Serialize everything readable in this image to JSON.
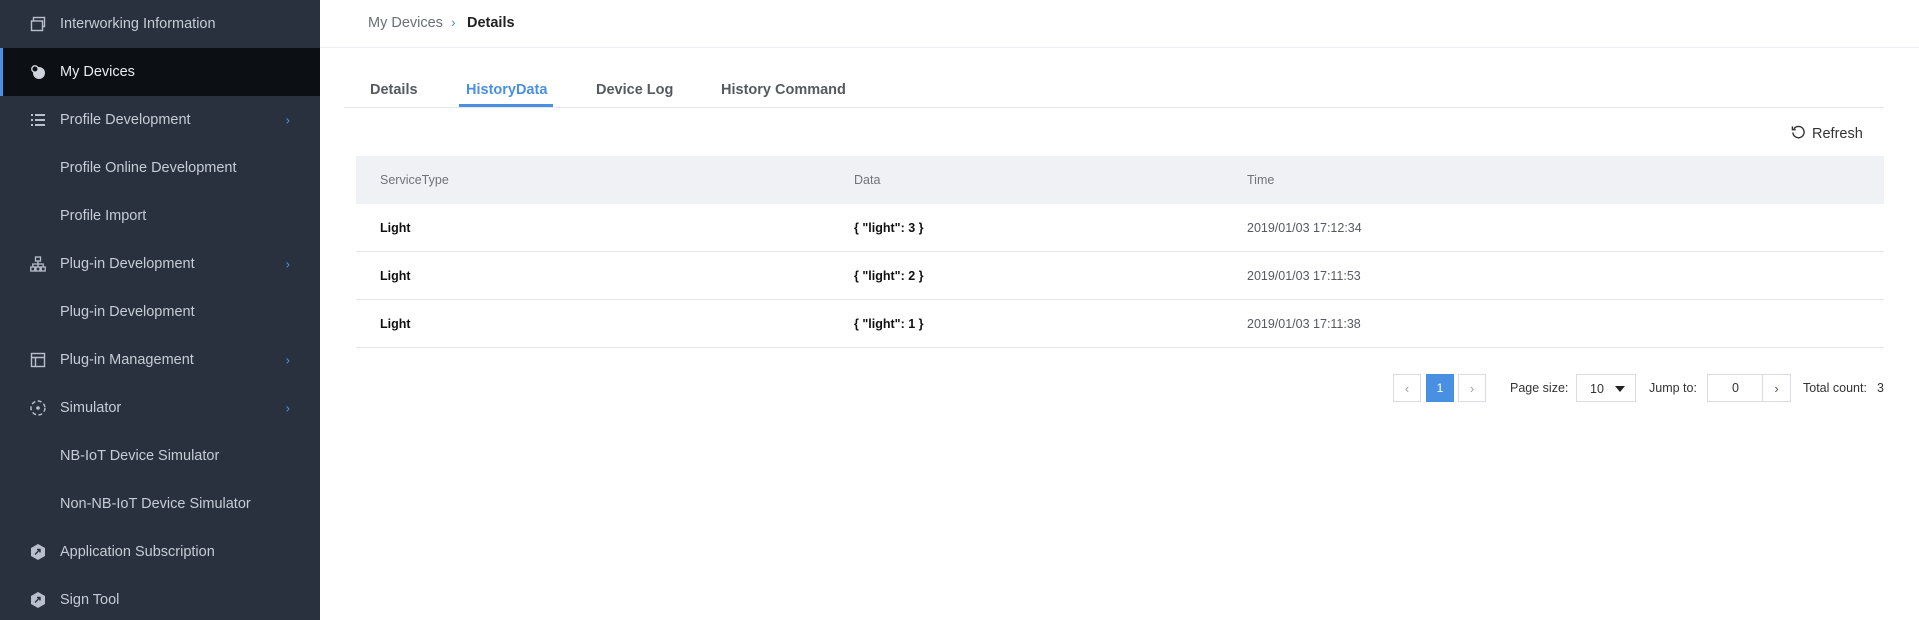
{
  "sidebar": {
    "items": [
      {
        "label": "Interworking Information",
        "icon": "window-icon"
      },
      {
        "label": "My Devices",
        "icon": "devices-icon",
        "active": true
      },
      {
        "label": "Profile Development",
        "icon": "list-icon",
        "expandable": true
      },
      {
        "label": "Profile Online Development"
      },
      {
        "label": "Profile Import"
      },
      {
        "label": "Plug-in Development",
        "icon": "hierarchy-icon",
        "expandable": true
      },
      {
        "label": "Plug-in Development"
      },
      {
        "label": "Plug-in Management",
        "icon": "panel-icon",
        "expandable": true
      },
      {
        "label": "Simulator",
        "icon": "simulator-icon",
        "expandable": true
      },
      {
        "label": "NB-IoT Device Simulator"
      },
      {
        "label": "Non-NB-IoT Device Simulator"
      },
      {
        "label": "Application Subscription",
        "icon": "hexagon-icon"
      },
      {
        "label": "Sign Tool",
        "icon": "hexagon-icon"
      }
    ]
  },
  "breadcrumb": {
    "parent": "My Devices",
    "current": "Details"
  },
  "tabs": [
    {
      "label": "Details"
    },
    {
      "label": "HistoryData",
      "active": true
    },
    {
      "label": "Device Log"
    },
    {
      "label": "History Command"
    }
  ],
  "toolbar": {
    "refresh_label": "Refresh"
  },
  "table": {
    "columns": [
      "ServiceType",
      "Data",
      "Time"
    ],
    "rows": [
      {
        "service": "Light",
        "data": "{ \"light\": 3 }",
        "time": "2019/01/03 17:12:34"
      },
      {
        "service": "Light",
        "data": "{ \"light\": 2 }",
        "time": "2019/01/03 17:11:53"
      },
      {
        "service": "Light",
        "data": "{ \"light\": 1 }",
        "time": "2019/01/03 17:11:38"
      }
    ]
  },
  "pagination": {
    "current_page": "1",
    "page_size_label": "Page size:",
    "page_size": "10",
    "jump_label": "Jump to:",
    "jump_value": "0",
    "total_label": "Total count:",
    "total": "3"
  },
  "colors": {
    "accent": "#4a90e2",
    "sidebar_bg": "#2a313e",
    "sidebar_active_bg": "#0c0f14"
  }
}
